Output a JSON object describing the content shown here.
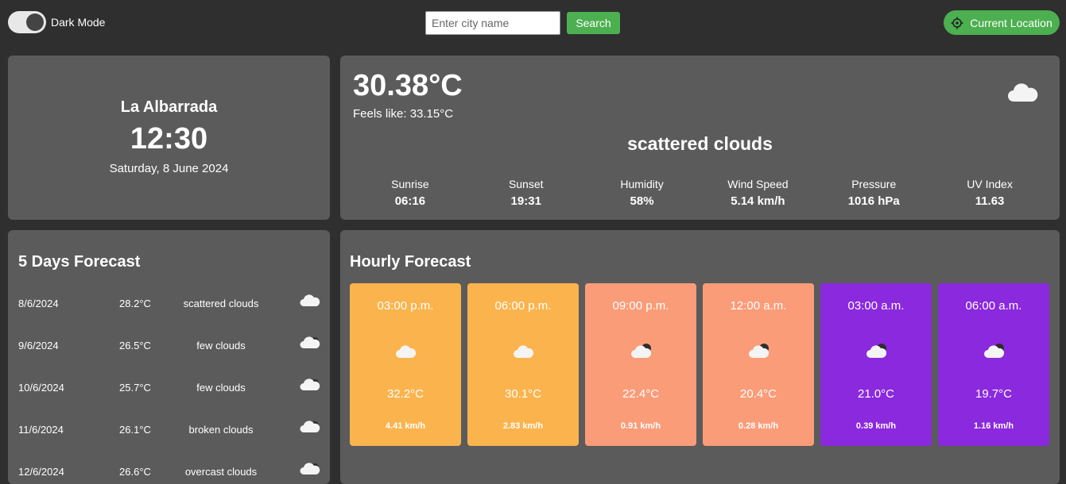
{
  "header": {
    "dark_mode_label": "Dark Mode",
    "search_placeholder": "Enter city name",
    "search_button": "Search",
    "current_location_button": "Current Location",
    "accent_color": "#4caf50",
    "location_icon": "crosshair-icon"
  },
  "city": {
    "name": "La Albarrada",
    "time": "12:30",
    "date": "Saturday, 8 June 2024"
  },
  "current": {
    "temperature": "30.38°C",
    "feels_like": "Feels like: 33.15°C",
    "description": "scattered clouds",
    "icon": "cloud-icon",
    "stats": [
      {
        "label": "Sunrise",
        "value": "06:16"
      },
      {
        "label": "Sunset",
        "value": "19:31"
      },
      {
        "label": "Humidity",
        "value": "58%"
      },
      {
        "label": "Wind Speed",
        "value": "5.14 km/h"
      },
      {
        "label": "Pressure",
        "value": "1016 hPa"
      },
      {
        "label": "UV Index",
        "value": "11.63"
      }
    ]
  },
  "forecast": {
    "title": "5 Days Forecast",
    "days": [
      {
        "date": "8/6/2024",
        "temp": "28.2°C",
        "desc": "scattered clouds",
        "icon": "cloud-icon"
      },
      {
        "date": "9/6/2024",
        "temp": "26.5°C",
        "desc": "few clouds",
        "icon": "cloud-moon-icon"
      },
      {
        "date": "10/6/2024",
        "temp": "25.7°C",
        "desc": "few clouds",
        "icon": "cloud-moon-icon"
      },
      {
        "date": "11/6/2024",
        "temp": "26.1°C",
        "desc": "broken clouds",
        "icon": "cloud-moon-icon"
      },
      {
        "date": "12/6/2024",
        "temp": "26.6°C",
        "desc": "overcast clouds",
        "icon": "cloud-moon-icon"
      }
    ]
  },
  "hourly": {
    "title": "Hourly Forecast",
    "items": [
      {
        "time": "03:00 p.m.",
        "temp": "32.2°C",
        "wind": "4.41 km/h",
        "color": "#fbb44d",
        "icon": "cloud-icon"
      },
      {
        "time": "06:00 p.m.",
        "temp": "30.1°C",
        "wind": "2.83 km/h",
        "color": "#fbb44d",
        "icon": "cloud-icon"
      },
      {
        "time": "09:00 p.m.",
        "temp": "22.4°C",
        "wind": "0.91 km/h",
        "color": "#fb9c78",
        "icon": "cloud-moon-icon"
      },
      {
        "time": "12:00 a.m.",
        "temp": "20.4°C",
        "wind": "0.28 km/h",
        "color": "#fb9c78",
        "icon": "cloud-moon-icon"
      },
      {
        "time": "03:00 a.m.",
        "temp": "21.0°C",
        "wind": "0.39 km/h",
        "color": "#8a29dd",
        "icon": "cloud-moon-icon"
      },
      {
        "time": "06:00 a.m.",
        "temp": "19.7°C",
        "wind": "1.16 km/h",
        "color": "#8a29dd",
        "icon": "cloud-moon-icon"
      }
    ]
  }
}
